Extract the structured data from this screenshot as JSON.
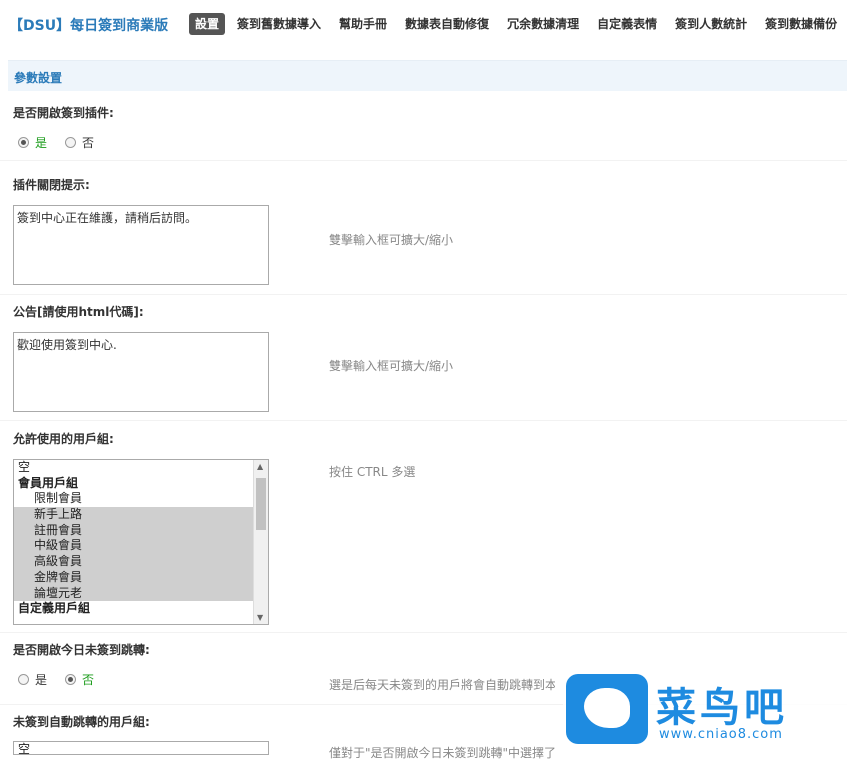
{
  "header": {
    "brand": "【DSU】每日簽到商業版",
    "nav": [
      "設置",
      "簽到舊數據導入",
      "幫助手冊",
      "數據表自動修復",
      "冗余數據清理",
      "自定義表情",
      "簽到人數統計",
      "簽到數據備份"
    ],
    "active_nav": "設置"
  },
  "section": {
    "title": "參數設置"
  },
  "fields": {
    "enable": {
      "label": "是否開啟簽到插件:",
      "options": [
        "是",
        "否"
      ],
      "selected": "是"
    },
    "closed_tip": {
      "label": "插件關閉提示:",
      "value": "簽到中心正在維護，請稍后訪問。",
      "hint": "雙擊輸入框可擴大/縮小"
    },
    "notice": {
      "label": "公告[請使用html代碼]:",
      "value": "歡迎使用簽到中心.",
      "hint": "雙擊輸入框可擴大/縮小"
    },
    "groups": {
      "label": "允許使用的用戶組:",
      "hint": "按住 CTRL 多選",
      "items": [
        {
          "text": "空",
          "kind": "plain",
          "selected": false
        },
        {
          "text": "會員用戶組",
          "kind": "group",
          "selected": false
        },
        {
          "text": "限制會員",
          "kind": "sub",
          "selected": false
        },
        {
          "text": "新手上路",
          "kind": "sub",
          "selected": true
        },
        {
          "text": "註冊會員",
          "kind": "sub",
          "selected": true
        },
        {
          "text": "中級會員",
          "kind": "sub",
          "selected": true
        },
        {
          "text": "高級會員",
          "kind": "sub",
          "selected": true
        },
        {
          "text": "金牌會員",
          "kind": "sub",
          "selected": true
        },
        {
          "text": "論壇元老",
          "kind": "sub",
          "selected": true
        },
        {
          "text": "自定義用戶組",
          "kind": "group",
          "selected": false
        }
      ]
    },
    "redirect": {
      "label": "是否開啟今日未簽到跳轉:",
      "options": [
        "是",
        "否"
      ],
      "selected": "否",
      "hint": "選是后每天未簽到的用戶將會自動跳轉到本"
    },
    "redirect_groups": {
      "label": "未簽到自動跳轉的用戶組:",
      "first_item": "空",
      "hint": "僅對于\"是否開啟今日未簽到跳轉\"中選擇了"
    }
  },
  "watermark": {
    "title": "菜鸟吧",
    "url": "www.cniao8.com"
  },
  "colors": {
    "accent": "#2b7bb9",
    "selected_green": "#1a9b1a",
    "active_tab": "#555555"
  }
}
